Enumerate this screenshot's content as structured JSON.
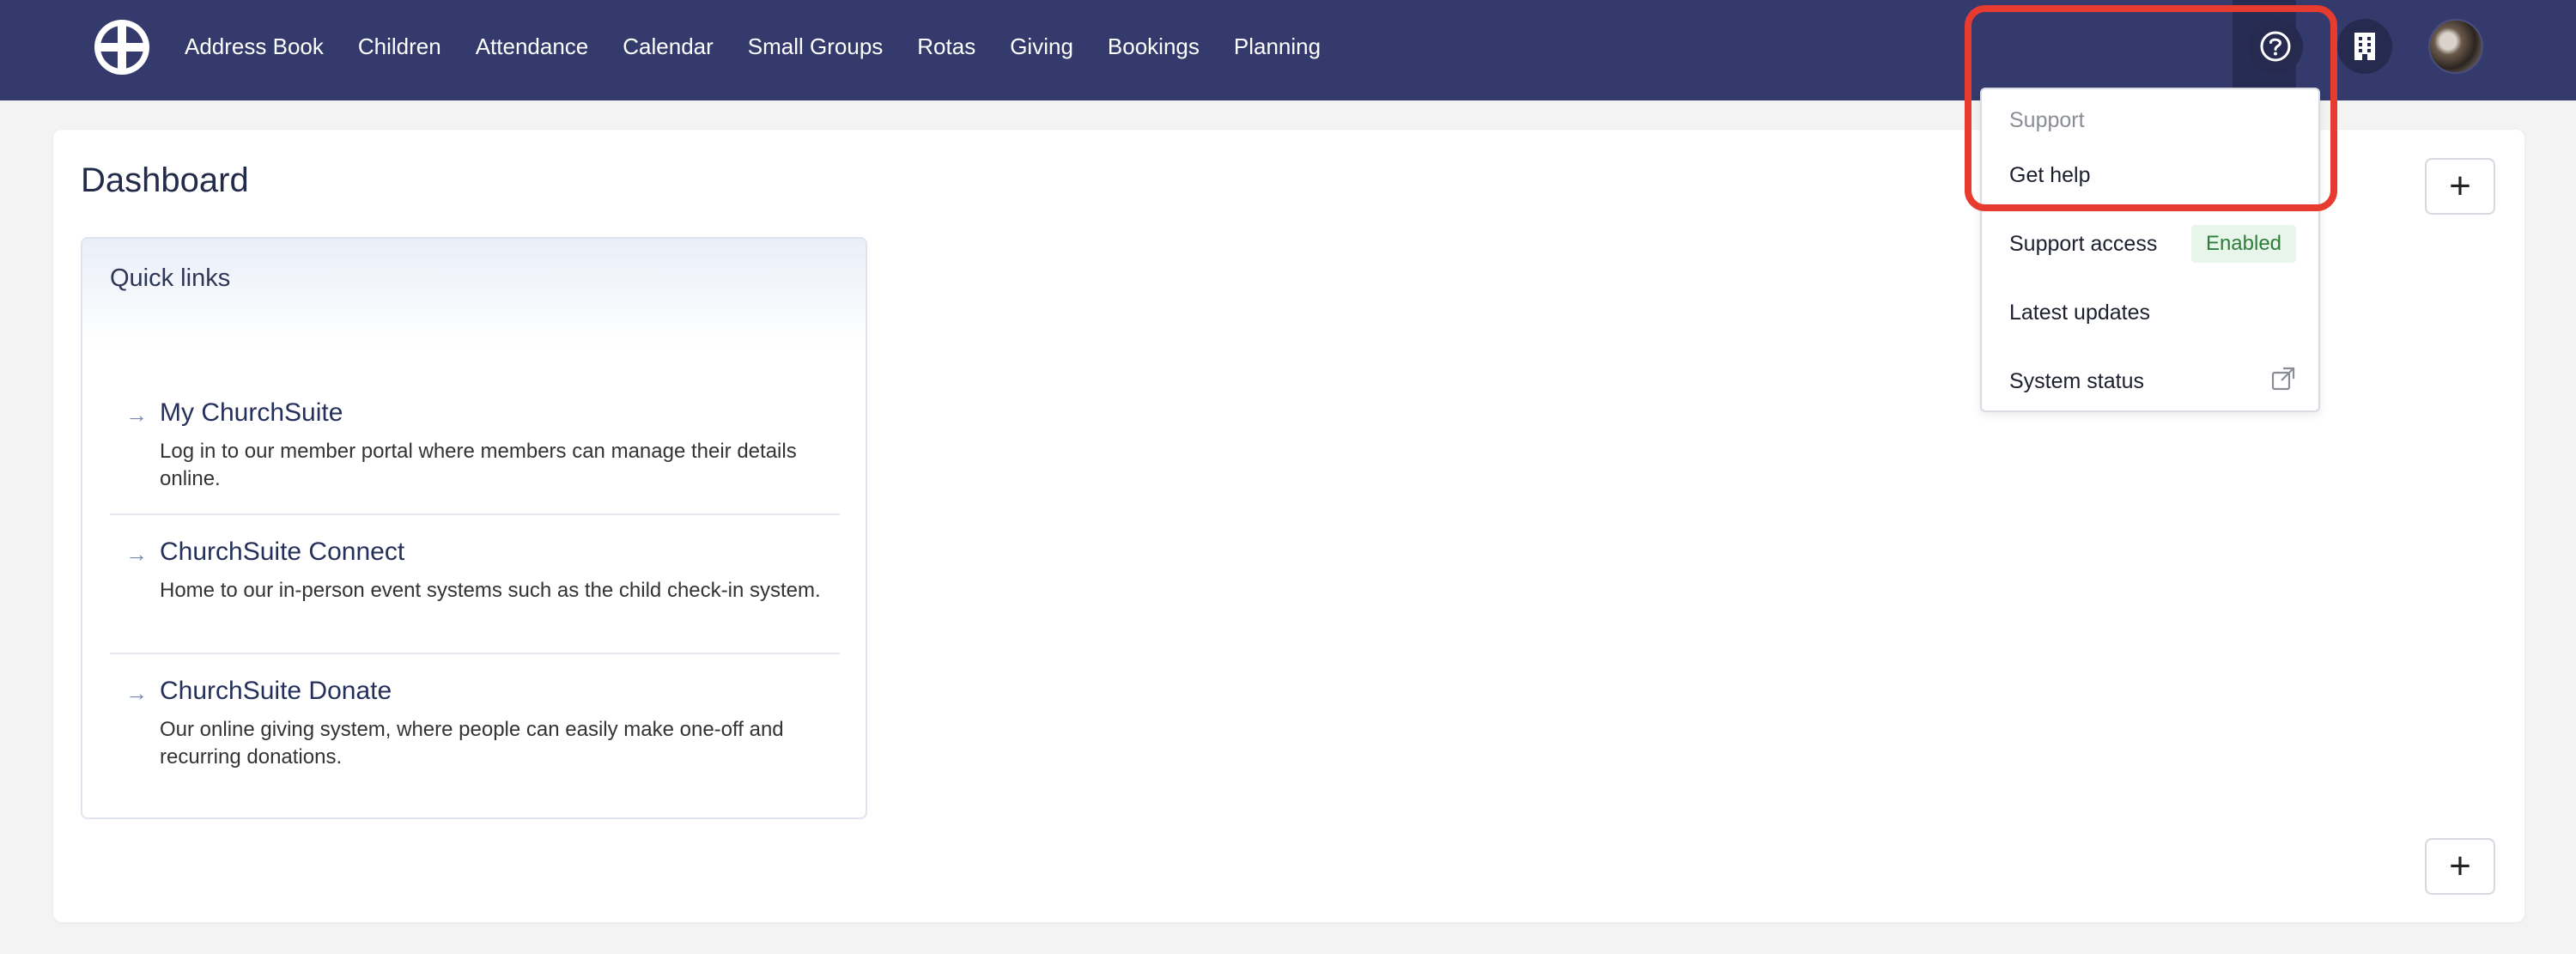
{
  "nav": {
    "items": [
      "Address Book",
      "Children",
      "Attendance",
      "Calendar",
      "Small Groups",
      "Rotas",
      "Giving",
      "Bookings",
      "Planning"
    ]
  },
  "icons": {
    "logo": "churchsuite-logo-icon",
    "help": "question-circle-icon",
    "organisation": "building-icon",
    "avatar": "user-avatar",
    "external": "external-link-icon",
    "arrow": "arrow-right-icon"
  },
  "colors": {
    "nav_bg": "#343a6b",
    "highlight": "#e63b2e",
    "badge_bg": "#e8f5ea",
    "badge_text": "#2e7d3a"
  },
  "main": {
    "title": "Dashboard",
    "add_label": "+",
    "quick_links": {
      "heading": "Quick links",
      "items": [
        {
          "title": "My ChurchSuite",
          "description": "Log in to our member portal where members can manage their details online."
        },
        {
          "title": "ChurchSuite Connect",
          "description": "Home to our in-person event systems such as the child check-in system."
        },
        {
          "title": "ChurchSuite Donate",
          "description": "Our online giving system, where people can easily make one-off and recurring donations."
        }
      ]
    }
  },
  "support_menu": {
    "header": "Support",
    "get_help": "Get help",
    "support_access": "Support access",
    "support_access_status": "Enabled",
    "latest_updates": "Latest updates",
    "system_status": "System status"
  }
}
